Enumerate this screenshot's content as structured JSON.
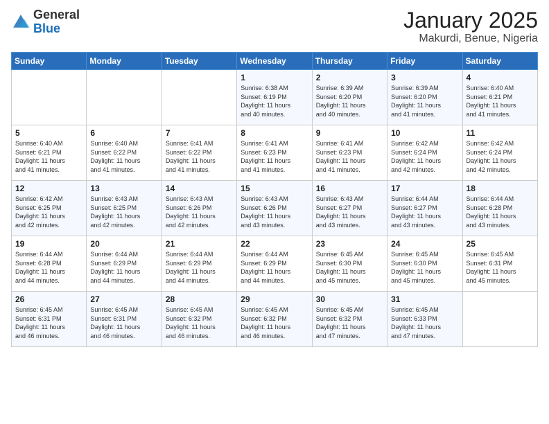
{
  "header": {
    "logo_general": "General",
    "logo_blue": "Blue",
    "month_year": "January 2025",
    "location": "Makurdi, Benue, Nigeria"
  },
  "days_of_week": [
    "Sunday",
    "Monday",
    "Tuesday",
    "Wednesday",
    "Thursday",
    "Friday",
    "Saturday"
  ],
  "weeks": [
    [
      {
        "day": "",
        "info": ""
      },
      {
        "day": "",
        "info": ""
      },
      {
        "day": "",
        "info": ""
      },
      {
        "day": "1",
        "info": "Sunrise: 6:38 AM\nSunset: 6:19 PM\nDaylight: 11 hours\nand 40 minutes."
      },
      {
        "day": "2",
        "info": "Sunrise: 6:39 AM\nSunset: 6:20 PM\nDaylight: 11 hours\nand 40 minutes."
      },
      {
        "day": "3",
        "info": "Sunrise: 6:39 AM\nSunset: 6:20 PM\nDaylight: 11 hours\nand 41 minutes."
      },
      {
        "day": "4",
        "info": "Sunrise: 6:40 AM\nSunset: 6:21 PM\nDaylight: 11 hours\nand 41 minutes."
      }
    ],
    [
      {
        "day": "5",
        "info": "Sunrise: 6:40 AM\nSunset: 6:21 PM\nDaylight: 11 hours\nand 41 minutes."
      },
      {
        "day": "6",
        "info": "Sunrise: 6:40 AM\nSunset: 6:22 PM\nDaylight: 11 hours\nand 41 minutes."
      },
      {
        "day": "7",
        "info": "Sunrise: 6:41 AM\nSunset: 6:22 PM\nDaylight: 11 hours\nand 41 minutes."
      },
      {
        "day": "8",
        "info": "Sunrise: 6:41 AM\nSunset: 6:23 PM\nDaylight: 11 hours\nand 41 minutes."
      },
      {
        "day": "9",
        "info": "Sunrise: 6:41 AM\nSunset: 6:23 PM\nDaylight: 11 hours\nand 41 minutes."
      },
      {
        "day": "10",
        "info": "Sunrise: 6:42 AM\nSunset: 6:24 PM\nDaylight: 11 hours\nand 42 minutes."
      },
      {
        "day": "11",
        "info": "Sunrise: 6:42 AM\nSunset: 6:24 PM\nDaylight: 11 hours\nand 42 minutes."
      }
    ],
    [
      {
        "day": "12",
        "info": "Sunrise: 6:42 AM\nSunset: 6:25 PM\nDaylight: 11 hours\nand 42 minutes."
      },
      {
        "day": "13",
        "info": "Sunrise: 6:43 AM\nSunset: 6:25 PM\nDaylight: 11 hours\nand 42 minutes."
      },
      {
        "day": "14",
        "info": "Sunrise: 6:43 AM\nSunset: 6:26 PM\nDaylight: 11 hours\nand 42 minutes."
      },
      {
        "day": "15",
        "info": "Sunrise: 6:43 AM\nSunset: 6:26 PM\nDaylight: 11 hours\nand 43 minutes."
      },
      {
        "day": "16",
        "info": "Sunrise: 6:43 AM\nSunset: 6:27 PM\nDaylight: 11 hours\nand 43 minutes."
      },
      {
        "day": "17",
        "info": "Sunrise: 6:44 AM\nSunset: 6:27 PM\nDaylight: 11 hours\nand 43 minutes."
      },
      {
        "day": "18",
        "info": "Sunrise: 6:44 AM\nSunset: 6:28 PM\nDaylight: 11 hours\nand 43 minutes."
      }
    ],
    [
      {
        "day": "19",
        "info": "Sunrise: 6:44 AM\nSunset: 6:28 PM\nDaylight: 11 hours\nand 44 minutes."
      },
      {
        "day": "20",
        "info": "Sunrise: 6:44 AM\nSunset: 6:29 PM\nDaylight: 11 hours\nand 44 minutes."
      },
      {
        "day": "21",
        "info": "Sunrise: 6:44 AM\nSunset: 6:29 PM\nDaylight: 11 hours\nand 44 minutes."
      },
      {
        "day": "22",
        "info": "Sunrise: 6:44 AM\nSunset: 6:29 PM\nDaylight: 11 hours\nand 44 minutes."
      },
      {
        "day": "23",
        "info": "Sunrise: 6:45 AM\nSunset: 6:30 PM\nDaylight: 11 hours\nand 45 minutes."
      },
      {
        "day": "24",
        "info": "Sunrise: 6:45 AM\nSunset: 6:30 PM\nDaylight: 11 hours\nand 45 minutes."
      },
      {
        "day": "25",
        "info": "Sunrise: 6:45 AM\nSunset: 6:31 PM\nDaylight: 11 hours\nand 45 minutes."
      }
    ],
    [
      {
        "day": "26",
        "info": "Sunrise: 6:45 AM\nSunset: 6:31 PM\nDaylight: 11 hours\nand 46 minutes."
      },
      {
        "day": "27",
        "info": "Sunrise: 6:45 AM\nSunset: 6:31 PM\nDaylight: 11 hours\nand 46 minutes."
      },
      {
        "day": "28",
        "info": "Sunrise: 6:45 AM\nSunset: 6:32 PM\nDaylight: 11 hours\nand 46 minutes."
      },
      {
        "day": "29",
        "info": "Sunrise: 6:45 AM\nSunset: 6:32 PM\nDaylight: 11 hours\nand 46 minutes."
      },
      {
        "day": "30",
        "info": "Sunrise: 6:45 AM\nSunset: 6:32 PM\nDaylight: 11 hours\nand 47 minutes."
      },
      {
        "day": "31",
        "info": "Sunrise: 6:45 AM\nSunset: 6:33 PM\nDaylight: 11 hours\nand 47 minutes."
      },
      {
        "day": "",
        "info": ""
      }
    ]
  ]
}
